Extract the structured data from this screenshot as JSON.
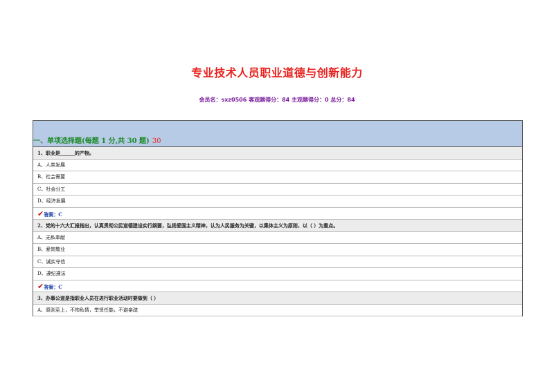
{
  "title": "专业技术人员职业道德与创新能力",
  "score_line": {
    "member_label": "会员名：",
    "member": "sxz0506",
    "objective_label": "客观题得分：",
    "objective": "84",
    "subjective_label": "主观题得分：",
    "subjective": "0",
    "total_label": "总分：",
    "total": "84"
  },
  "section": {
    "title": "一、单项选择题(每题 1 分,共 30 题)",
    "score": "30"
  },
  "questions": [
    {
      "text": "1、职业是______的产物。",
      "options": [
        "A、人类发展",
        "B、社会需要",
        "C、社会分工",
        "D、经济发展"
      ],
      "answer": "答案：C"
    },
    {
      "text": "2、党的十六大汇报指出，认真贯彻公民道德建设实行纲要，弘扬爱国主义精神，认为人民服务为关键，以集体主义为原则，以（ ）为重点。",
      "options": [
        "A、无私奉献",
        "B、爱岗敬业",
        "C、诚实守信",
        "D、遵纪遵法"
      ],
      "answer": "答案：C"
    },
    {
      "text": "3、办事公道是指职业人员在进行职业活动时要做到（ ）",
      "options": [
        "A、原则至上，不徇私情，举贤任能，不避亲疏"
      ]
    }
  ]
}
